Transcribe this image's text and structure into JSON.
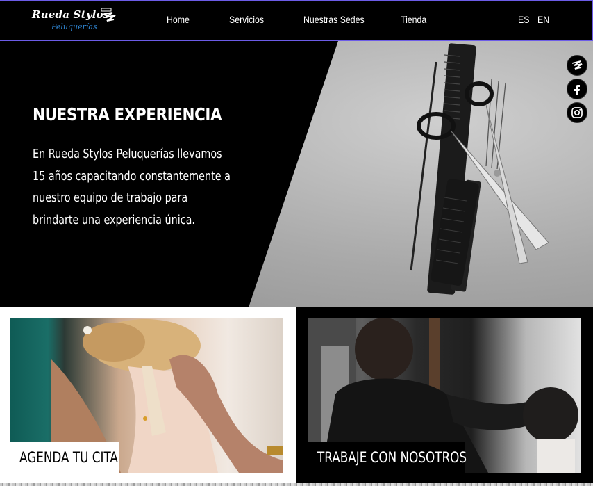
{
  "header": {
    "logo": {
      "main": "Rueda Stylos",
      "sub": "Peluquerías"
    },
    "nav": [
      "Home",
      "Servicios",
      "Nuestras Sedes",
      "Tienda"
    ],
    "languages": [
      "ES",
      "EN"
    ]
  },
  "hero": {
    "title": "NUESTRA EXPERIENCIA",
    "lines": [
      "En Rueda Stylos Peluquerías llevamos",
      "15 años capacitando constantemente a",
      "nuestro equipo de trabajo para",
      "brindarte una experiencia única."
    ]
  },
  "social": [
    "brand-icon",
    "facebook-icon",
    "instagram-icon"
  ],
  "cards": {
    "left_cta": "AGENDA TU CITA",
    "right_cta": "TRABAJE CON NOSOTROS"
  },
  "colors": {
    "accent": "#6c5ce7",
    "logo_blue": "#2f86d4"
  }
}
